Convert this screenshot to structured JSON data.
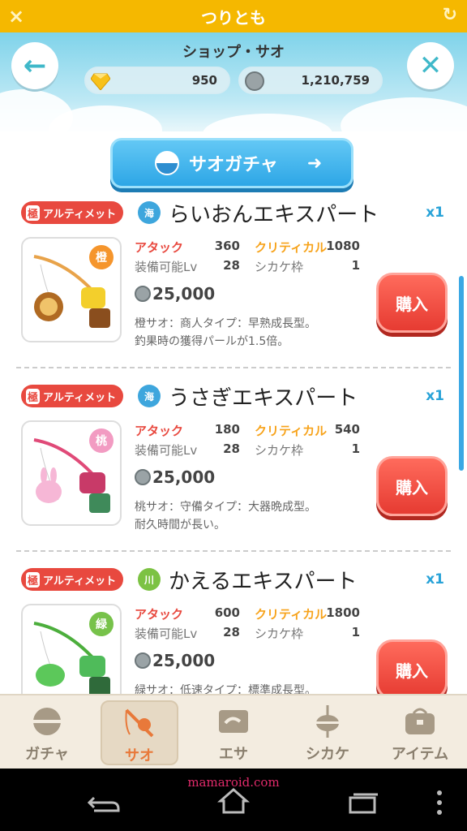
{
  "appbar": {
    "title": "つりとも",
    "close_icon": "×",
    "refresh_icon": "↻"
  },
  "header": {
    "title": "ショップ・サオ",
    "back_icon": "←",
    "close_icon": "✕",
    "gems": "950",
    "pearls": "1,210,759"
  },
  "gacha_button": {
    "label": "サオガチャ",
    "arrow": "➜"
  },
  "items": [
    {
      "badge_prefix": "極",
      "badge": "アルティメット",
      "water": "海",
      "water_color": "#3ea6dd",
      "name": "らいおんエキスパート",
      "qty": "x1",
      "color_tag": "橙",
      "color_tag_color": "#f5952c",
      "attack_label": "アタック",
      "attack": "360",
      "critical_label": "クリティカル",
      "critical": "1080",
      "level_label": "装備可能Lv",
      "level": "28",
      "slot_label": "シカケ枠",
      "slot": "1",
      "price": "25,000",
      "desc1": "橙サオ：商人タイプ：早熟成長型。",
      "desc2": "釣果時の獲得パールが1.5倍。",
      "buy": "購入"
    },
    {
      "badge_prefix": "極",
      "badge": "アルティメット",
      "water": "海",
      "water_color": "#3ea6dd",
      "name": "うさぎエキスパート",
      "qty": "x1",
      "color_tag": "桃",
      "color_tag_color": "#f29bc2",
      "attack_label": "アタック",
      "attack": "180",
      "critical_label": "クリティカル",
      "critical": "540",
      "level_label": "装備可能Lv",
      "level": "28",
      "slot_label": "シカケ枠",
      "slot": "1",
      "price": "25,000",
      "desc1": "桃サオ：守備タイプ：大器晩成型。",
      "desc2": "耐久時間が長い。",
      "buy": "購入"
    },
    {
      "badge_prefix": "極",
      "badge": "アルティメット",
      "water": "川",
      "water_color": "#7cc243",
      "name": "かえるエキスパート",
      "qty": "x1",
      "color_tag": "緑",
      "color_tag_color": "#77c24a",
      "attack_label": "アタック",
      "attack": "600",
      "critical_label": "クリティカル",
      "critical": "1800",
      "level_label": "装備可能Lv",
      "level": "28",
      "slot_label": "シカケ枠",
      "slot": "1",
      "price": "25,000",
      "desc1": "緑サオ：低速タイプ：標準成長型。",
      "desc2": "",
      "buy": "購入"
    }
  ],
  "tabs": [
    {
      "label": "ガチャ",
      "icon": "gacha-ball-icon"
    },
    {
      "label": "サオ",
      "icon": "fishing-rod-icon",
      "active": true
    },
    {
      "label": "エサ",
      "icon": "bait-icon"
    },
    {
      "label": "シカケ",
      "icon": "float-icon"
    },
    {
      "label": "アイテム",
      "icon": "bag-icon"
    }
  ],
  "watermark": "mamaroid.com"
}
